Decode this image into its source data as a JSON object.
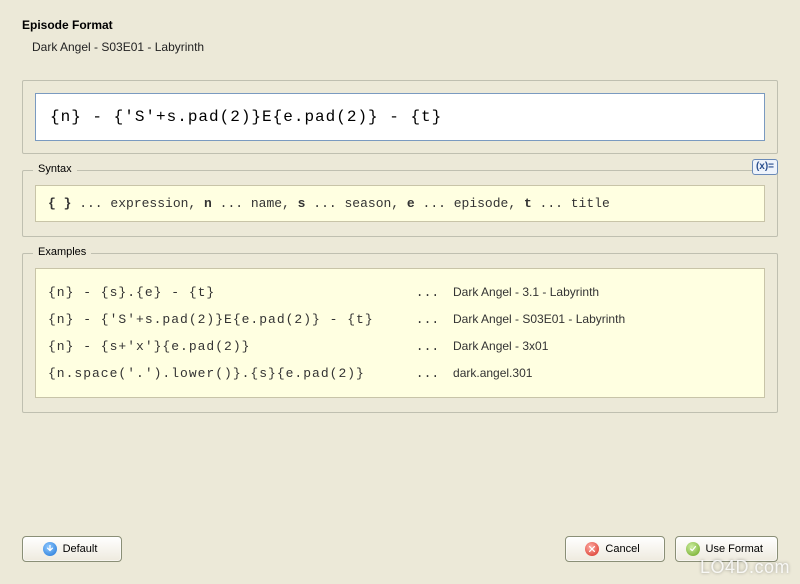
{
  "header": {
    "title": "Episode Format",
    "preview": "Dark Angel - S03E01 - Labyrinth"
  },
  "format_input": "{n} - {'S'+s.pad(2)}E{e.pad(2)} - {t}",
  "syntax": {
    "legend": "Syntax",
    "text_html": "<b>{ }</b> ... expression, <b>n</b> ... name, <b>s</b> ... season, <b>e</b> ... episode, <b>t</b> ... title",
    "fx_label": "(x)="
  },
  "examples": {
    "legend": "Examples",
    "rows": [
      {
        "pattern": "{n} - {s}.{e} - {t}",
        "result": "Dark Angel - 3.1 - Labyrinth"
      },
      {
        "pattern": "{n} - {'S'+s.pad(2)}E{e.pad(2)} - {t}",
        "result": "Dark Angel - S03E01 - Labyrinth"
      },
      {
        "pattern": "{n} - {s+'x'}{e.pad(2)}",
        "result": "Dark Angel - 3x01"
      },
      {
        "pattern": "{n.space('.').lower()}.{s}{e.pad(2)}",
        "result": "dark.angel.301"
      }
    ],
    "dots": " ... "
  },
  "buttons": {
    "default": "Default",
    "cancel": "Cancel",
    "use_format": "Use Format"
  },
  "watermark": "LO4D.com"
}
